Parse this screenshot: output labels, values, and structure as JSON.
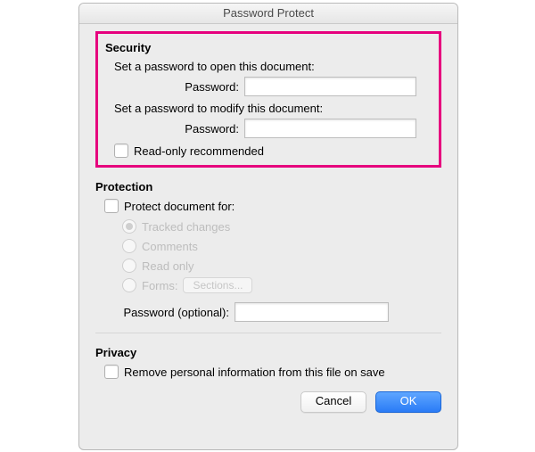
{
  "window": {
    "title": "Password Protect"
  },
  "security": {
    "heading": "Security",
    "open_prompt": "Set a password to open this document:",
    "open_label": "Password:",
    "open_value": "",
    "modify_prompt": "Set a password to modify this document:",
    "modify_label": "Password:",
    "modify_value": "",
    "readonly_label": "Read-only recommended"
  },
  "protection": {
    "heading": "Protection",
    "protect_for_label": "Protect document for:",
    "options": {
      "tracked": "Tracked changes",
      "comments": "Comments",
      "readonly": "Read only",
      "forms": "Forms:"
    },
    "sections_button": "Sections...",
    "password_label": "Password (optional):",
    "password_value": ""
  },
  "privacy": {
    "heading": "Privacy",
    "remove_pi_label": "Remove personal information from this file on save"
  },
  "buttons": {
    "cancel": "Cancel",
    "ok": "OK"
  }
}
